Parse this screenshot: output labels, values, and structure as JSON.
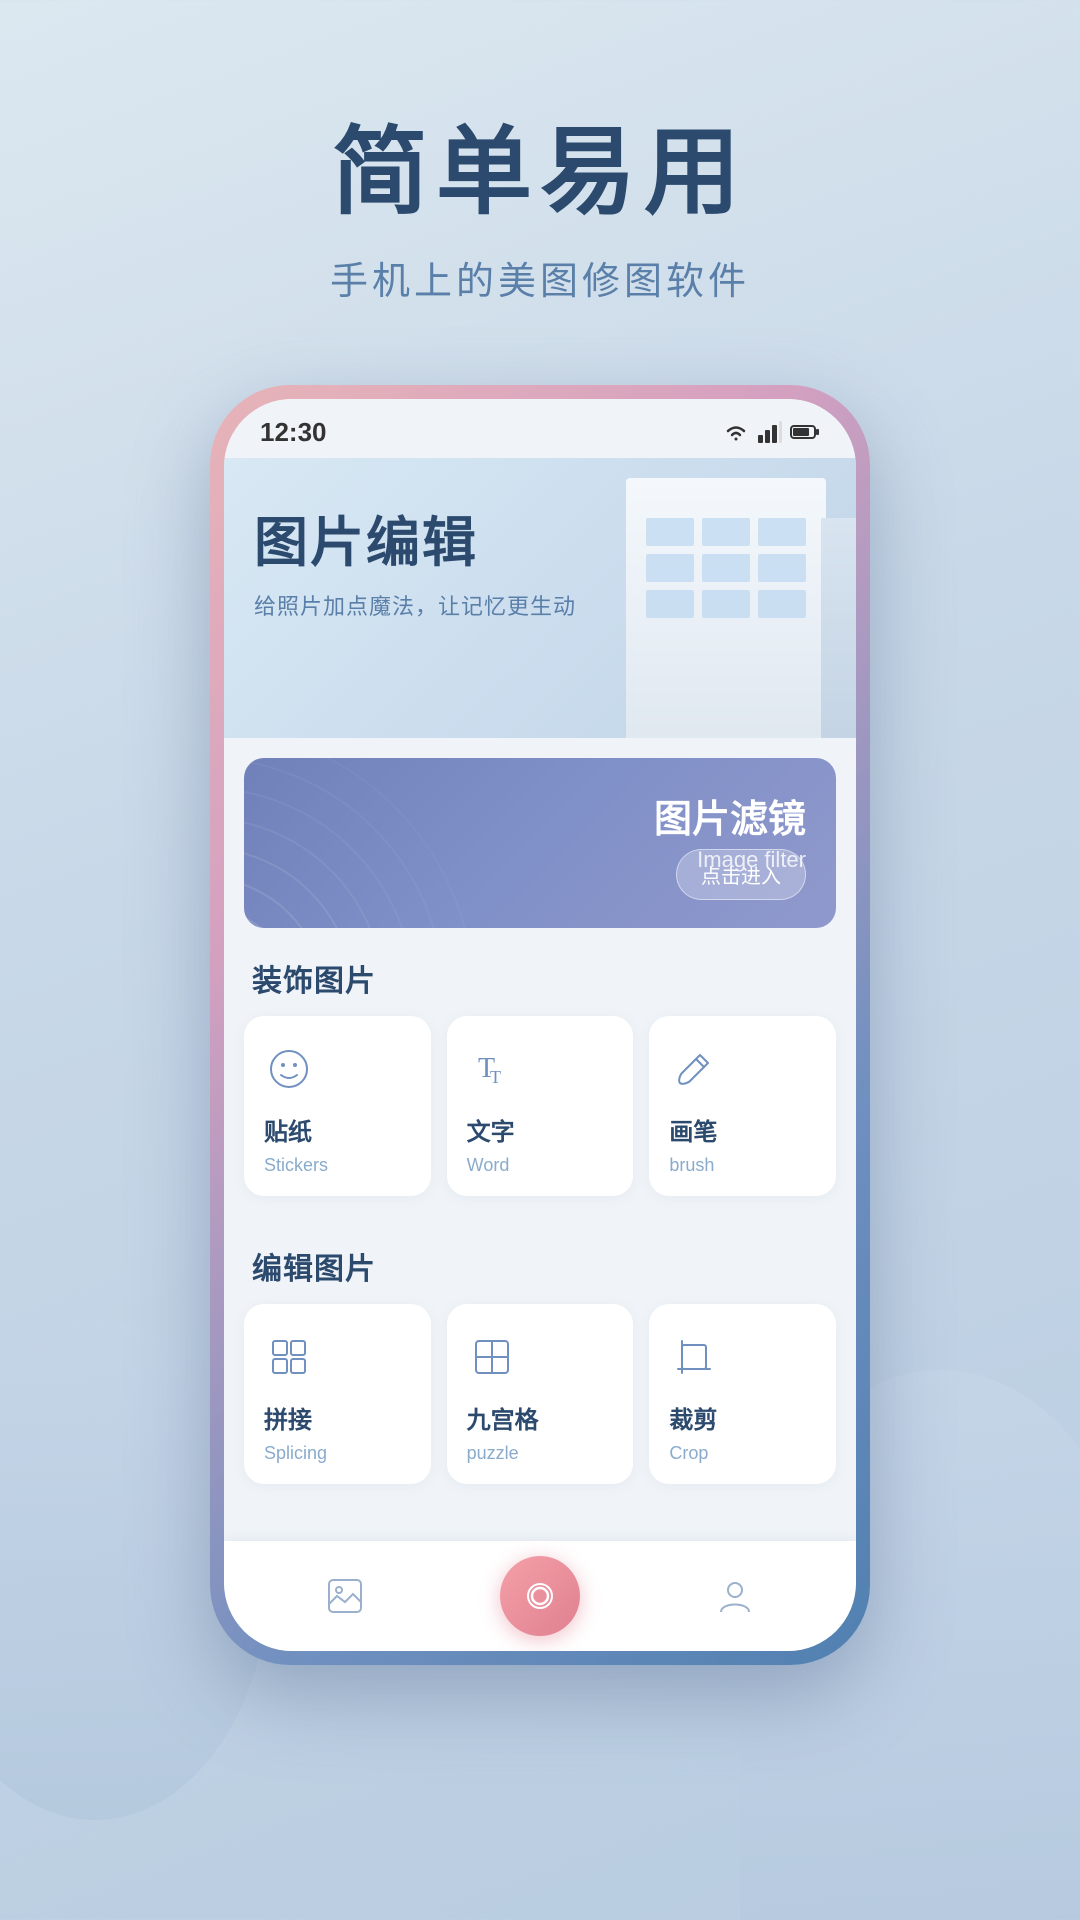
{
  "page": {
    "background": "#d0dde8"
  },
  "header": {
    "main_title": "简单易用",
    "sub_title": "手机上的美图修图软件"
  },
  "phone": {
    "status_bar": {
      "time": "12:30",
      "wifi": "📶",
      "signal": "📶",
      "battery": "🔋"
    },
    "hero": {
      "title_cn": "图片编辑",
      "subtitle_cn": "给照片加点魔法，让记忆更生动"
    },
    "filter_card": {
      "title_cn": "图片滤镜",
      "title_en": "Image filter",
      "button_label": "点击进入"
    },
    "sections": [
      {
        "id": "decorate",
        "title": "装饰图片",
        "tools": [
          {
            "id": "stickers",
            "name_cn": "贴纸",
            "name_en": "Stickers",
            "icon": "sticker"
          },
          {
            "id": "text",
            "name_cn": "文字",
            "name_en": "Word",
            "icon": "text"
          },
          {
            "id": "brush",
            "name_cn": "画笔",
            "name_en": "brush",
            "icon": "brush"
          }
        ]
      },
      {
        "id": "edit",
        "title": "编辑图片",
        "tools": [
          {
            "id": "splice",
            "name_cn": "拼接",
            "name_en": "Splicing",
            "icon": "splice"
          },
          {
            "id": "puzzle",
            "name_cn": "九宫格",
            "name_en": "puzzle",
            "icon": "puzzle"
          },
          {
            "id": "crop",
            "name_cn": "裁剪",
            "name_en": "Crop",
            "icon": "crop"
          }
        ]
      }
    ],
    "nav": {
      "items": [
        {
          "id": "gallery",
          "icon": "photo"
        },
        {
          "id": "camera",
          "icon": "camera"
        },
        {
          "id": "profile",
          "icon": "person"
        }
      ]
    }
  }
}
